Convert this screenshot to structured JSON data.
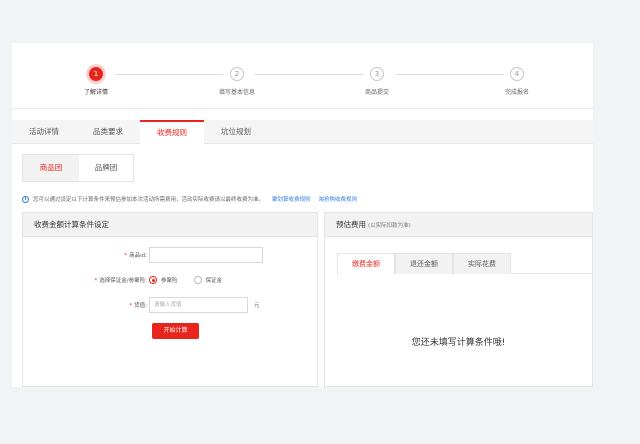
{
  "steps": [
    {
      "num": "1",
      "label": "了解详情",
      "active": true
    },
    {
      "num": "2",
      "label": "填写基本信息",
      "active": false
    },
    {
      "num": "3",
      "label": "商品提交",
      "active": false
    },
    {
      "num": "4",
      "label": "完成报名",
      "active": false
    }
  ],
  "main_tabs": [
    "活动详情",
    "品类要求",
    "收费规则",
    "坑位规划"
  ],
  "main_tab_active": "收费规则",
  "sub_tabs": [
    "商品团",
    "品牌团"
  ],
  "sub_tab_active": "商品团",
  "info": {
    "icon": "info-icon",
    "text": "您可以通过设定以下计算条件来预估参加本次活动所需费用，活动实际收费请以最终收费为准。",
    "link1": "聚划算收费规则",
    "link2": "淘抢购收费规则"
  },
  "calc_panel": {
    "title": "收费金额计算条件设定",
    "product_id_label": "商品id:",
    "product_id_value": "",
    "deposit_label": "选择保证金/参聚险:",
    "deposit_options": [
      "参聚险",
      "保证金"
    ],
    "deposit_selected": "参聚险",
    "price_label": "货值:",
    "price_placeholder": "请输入货值",
    "price_unit": "元",
    "submit_label": "开始计算"
  },
  "estimate_panel": {
    "title": "预估费用",
    "title_note": "(以实际扣款为准)",
    "tabs": [
      "缴费金额",
      "退还金额",
      "实际花费"
    ],
    "tab_active": "缴费金额",
    "empty_message": "您还未填写计算条件哦!"
  },
  "colors": {
    "accent": "#e8251d",
    "link": "#2f7de1",
    "background": "#f2f3f5"
  }
}
